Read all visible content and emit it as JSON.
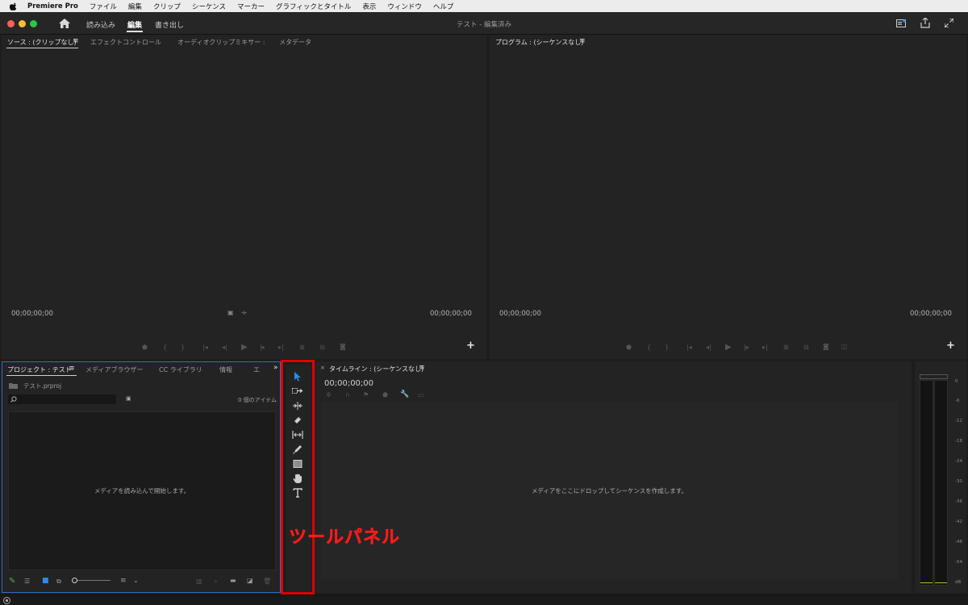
{
  "menubar": {
    "app_name": "Premiere Pro",
    "items": [
      "ファイル",
      "編集",
      "クリップ",
      "シーケンス",
      "マーカー",
      "グラフィックとタイトル",
      "表示",
      "ウィンドウ",
      "ヘルプ"
    ]
  },
  "titlebar": {
    "workspace_tabs": [
      "読み込み",
      "編集",
      "書き出し"
    ],
    "active_workspace": "編集",
    "document_title": "テスト - 編集済み"
  },
  "source_panel": {
    "tabs": [
      "ソース : (クリップなし)",
      "エフェクトコントロール",
      "オーディオクリップミキサー :",
      "メタデータ"
    ],
    "timecode_left": "00;00;00;00",
    "timecode_right": "00;00;00;00"
  },
  "program_panel": {
    "tab": "プログラム : (シーケンスなし)",
    "timecode_left": "00;00;00;00",
    "timecode_right": "00;00;00;00"
  },
  "project_panel": {
    "tabs": [
      "プロジェクト : テスト",
      "メディアブラウザー",
      "CC ライブラリ",
      "情報",
      "エ"
    ],
    "project_file": "テスト.prproj",
    "search_placeholder": "",
    "item_count": "0 個のアイテム",
    "empty_message": "メディアを読み込んで開始します。"
  },
  "timeline_panel": {
    "tab": "タイムライン : (シーケンスなし)",
    "timecode": "00;00;00;00",
    "empty_message": "メディアをここにドロップしてシーケンスを作成します。"
  },
  "tools": [
    "selection-tool",
    "track-select-forward-tool",
    "ripple-edit-tool",
    "razor-tool",
    "slip-tool",
    "pen-tool",
    "rectangle-tool",
    "hand-tool",
    "type-tool"
  ],
  "audio_meter": {
    "scale": [
      "0",
      "-6",
      "-12",
      "-18",
      "-24",
      "-30",
      "-36",
      "-42",
      "-48",
      "-54",
      "dB"
    ]
  },
  "annotation": {
    "label": "ツールパネル",
    "color": "#e00000"
  },
  "colors": {
    "accent_blue": "#2d8ceb",
    "panel_bg": "#232323",
    "frame_bg": "#1d1d1d"
  }
}
